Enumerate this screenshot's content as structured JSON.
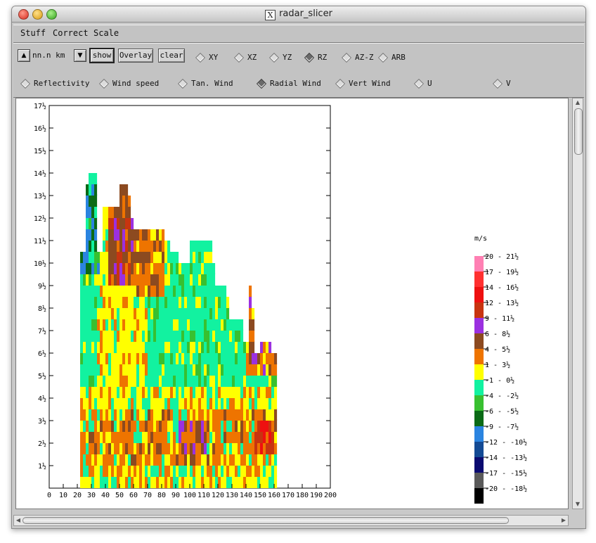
{
  "window": {
    "title": "radar_slicer"
  },
  "menubar": {
    "items": [
      "Stuff",
      "Correct",
      "Scale"
    ]
  },
  "toolbar": {
    "distance_label": "nn.n km",
    "show_label": "show",
    "overlay_label": "Overlay",
    "clear_label": "clear",
    "views": [
      {
        "label": "XY",
        "selected": false
      },
      {
        "label": "XZ",
        "selected": false
      },
      {
        "label": "YZ",
        "selected": false
      },
      {
        "label": "RZ",
        "selected": true
      },
      {
        "label": "AZ-Z",
        "selected": false
      },
      {
        "label": "ARB",
        "selected": false
      }
    ],
    "fields": [
      {
        "label": "Reflectivity",
        "selected": false
      },
      {
        "label": "Wind speed",
        "selected": false
      },
      {
        "label": "Tan. Wind",
        "selected": false
      },
      {
        "label": "Radial Wind",
        "selected": true
      },
      {
        "label": "Vert Wind",
        "selected": false
      },
      {
        "label": "U",
        "selected": false
      },
      {
        "label": "V",
        "selected": false
      }
    ]
  },
  "plot": {
    "y_tick_labels": [
      "17½",
      "16½",
      "15½",
      "14½",
      "13½",
      "12½",
      "11½",
      "10½",
      "9½",
      "8½",
      "7½",
      "6½",
      "5½",
      "4½",
      "3½",
      "2½",
      "1½"
    ],
    "x_tick_labels": [
      "0",
      "10",
      "20",
      "30",
      "40",
      "50",
      "60",
      "70",
      "80",
      "90",
      "100",
      "110",
      "120",
      "130",
      "140",
      "150",
      "160",
      "170",
      "180",
      "190",
      "200"
    ],
    "legend_unit": "m/s",
    "legend": [
      {
        "label": "20 - 21½",
        "color": "#ff7fb3"
      },
      {
        "label": "17 - 19½",
        "color": "#ff3030"
      },
      {
        "label": "14 - 16½",
        "color": "#ee1010"
      },
      {
        "label": "12 - 13½",
        "color": "#c83410"
      },
      {
        "label": "9 - 11½",
        "color": "#9b30e0"
      },
      {
        "label": "6 - 8½",
        "color": "#8c4a20"
      },
      {
        "label": "4 - 5½",
        "color": "#ee7400"
      },
      {
        "label": "1 - 3½",
        "color": "#ffff00"
      },
      {
        "label": "-1 - 0½",
        "color": "#12f2a0"
      },
      {
        "label": "-4 - -2½",
        "color": "#38c030"
      },
      {
        "label": "-6 - -5½",
        "color": "#0a6a16"
      },
      {
        "label": "-9 - -7½",
        "color": "#2a84e0"
      },
      {
        "label": "-12 - -10½",
        "color": "#134a94"
      },
      {
        "label": "-14 - -13½",
        "color": "#0a0a70"
      },
      {
        "label": "-17 - -15½",
        "color": "#5a5a5a"
      },
      {
        "label": "-20 - -18½",
        "color": "#000000"
      }
    ]
  }
}
